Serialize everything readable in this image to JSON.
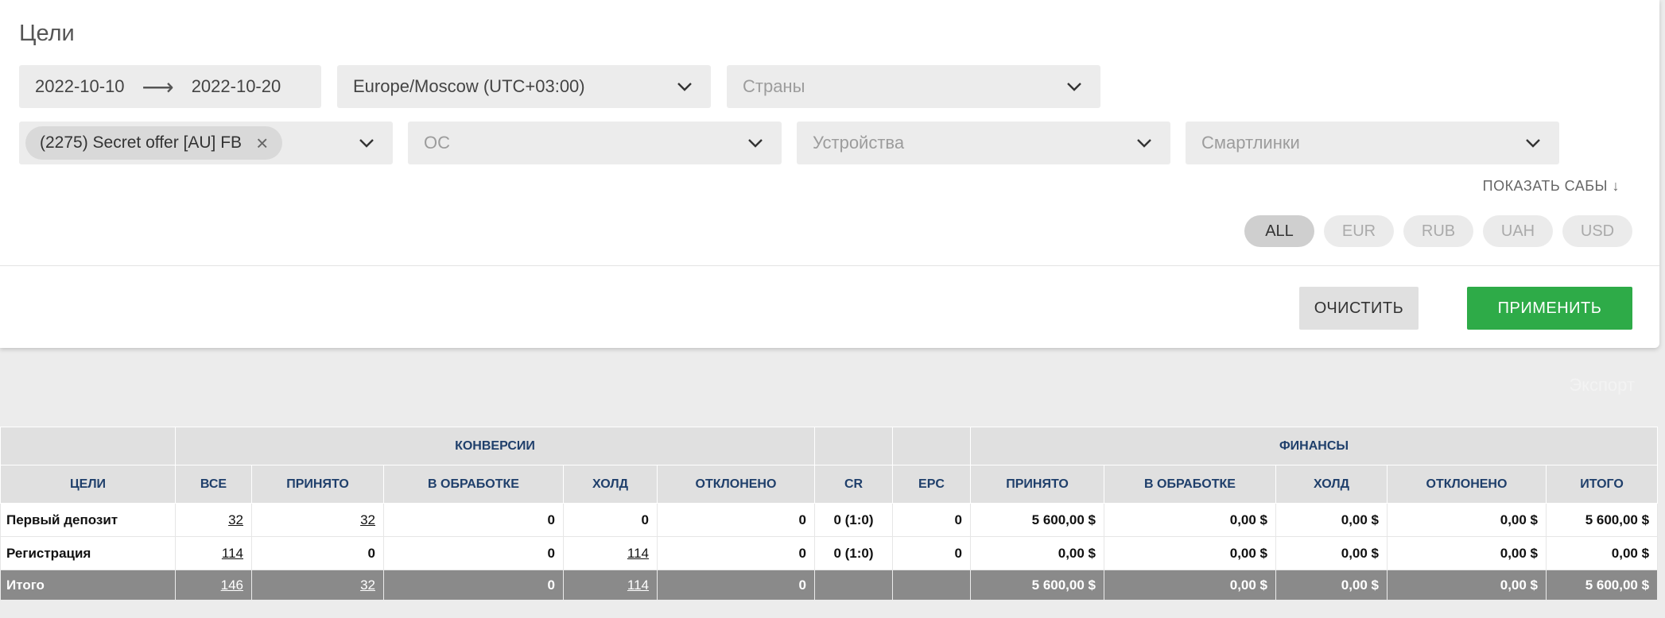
{
  "page": {
    "title": "Цели"
  },
  "filters": {
    "date_from": "2022-10-10",
    "date_to": "2022-10-20",
    "timezone": "Europe/Moscow (UTC+03:00)",
    "countries_placeholder": "Страны",
    "offer_chip": "(2275) Secret offer [AU] FB",
    "os_placeholder": "ОС",
    "devices_placeholder": "Устройства",
    "smartlinks_placeholder": "Смартлинки",
    "show_subs": "ПОКАЗАТЬ САБЫ ↓",
    "currencies": [
      "ALL",
      "EUR",
      "RUB",
      "UAH",
      "USD"
    ],
    "active_currency": "ALL",
    "clear_label": "ОЧИСТИТЬ",
    "apply_label": "ПРИМЕНИТЬ",
    "accent_color": "#2eab48"
  },
  "export_label": "Экспорт",
  "table": {
    "groups": {
      "conversions": "КОНВЕРСИИ",
      "finance": "ФИНАНСЫ"
    },
    "headers": [
      "ЦЕЛИ",
      "ВСЕ",
      "ПРИНЯТО",
      "В ОБРАБОТКЕ",
      "ХОЛД",
      "ОТКЛОНЕНО",
      "CR",
      "EPC",
      "ПРИНЯТО",
      "В ОБРАБОТКЕ",
      "ХОЛД",
      "ОТКЛОНЕНО",
      "ИТОГО"
    ],
    "rows": [
      {
        "name": "Первый депозит",
        "all": "32",
        "accepted": "32",
        "processing": "0",
        "hold": "0",
        "rejected": "0",
        "cr": "0 (1:0)",
        "epc": "0",
        "f_accepted": "5 600,00 $",
        "f_processing": "0,00 $",
        "f_hold": "0,00 $",
        "f_rejected": "0,00 $",
        "f_total": "5 600,00 $"
      },
      {
        "name": "Регистрация",
        "all": "114",
        "accepted": "0",
        "processing": "0",
        "hold": "114",
        "rejected": "0",
        "cr": "0 (1:0)",
        "epc": "0",
        "f_accepted": "0,00 $",
        "f_processing": "0,00 $",
        "f_hold": "0,00 $",
        "f_rejected": "0,00 $",
        "f_total": "0,00 $"
      }
    ],
    "total": {
      "name": "Итого",
      "all": "146",
      "accepted": "32",
      "processing": "0",
      "hold": "114",
      "rejected": "0",
      "cr": "",
      "epc": "",
      "f_accepted": "5 600,00 $",
      "f_processing": "0,00 $",
      "f_hold": "0,00 $",
      "f_rejected": "0,00 $",
      "f_total": "5 600,00 $"
    }
  }
}
